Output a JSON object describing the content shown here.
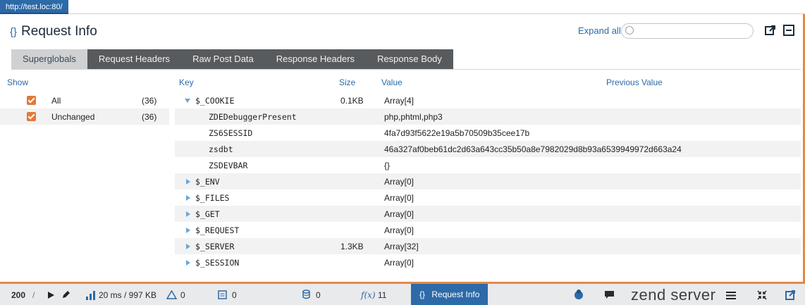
{
  "url_tab": "http://test.loc:80/",
  "header": {
    "brace": "{}",
    "title": "Request Info",
    "expand_all": "Expand all",
    "search_placeholder": "",
    "export_icon": "export-icon",
    "collapse_icon": "collapse-icon"
  },
  "tabs": [
    {
      "label": "Superglobals",
      "active": true
    },
    {
      "label": "Request Headers",
      "active": false
    },
    {
      "label": "Raw Post Data",
      "active": false
    },
    {
      "label": "Response Headers",
      "active": false
    },
    {
      "label": "Response Body",
      "active": false
    }
  ],
  "columns": {
    "show": "Show",
    "key": "Key",
    "size": "Size",
    "value": "Value",
    "previous_value": "Previous Value"
  },
  "show_filters": [
    {
      "label": "All",
      "count": "(36)",
      "checked": true
    },
    {
      "label": "Unchanged",
      "count": "(36)",
      "checked": true
    }
  ],
  "rows": [
    {
      "key": "$_COOKIE",
      "size": "0.1KB",
      "value": "Array[4]",
      "expandable": true,
      "expanded": true
    },
    {
      "key": "ZDEDebuggerPresent",
      "size": "",
      "value": "php,phtml,php3",
      "child": true
    },
    {
      "key": "ZS6SESSID",
      "size": "",
      "value": "4fa7d93f5622e19a5b70509b35cee17b",
      "child": true
    },
    {
      "key": "zsdbt",
      "size": "",
      "value": "46a327af0beb61dc2d63a643cc35b50a8e7982029d8b93a6539949972d663a24",
      "child": true
    },
    {
      "key": "ZSDEVBAR",
      "size": "",
      "value": "{}",
      "child": true
    },
    {
      "key": "$_ENV",
      "size": "",
      "value": "Array[0]",
      "expandable": true
    },
    {
      "key": "$_FILES",
      "size": "",
      "value": "Array[0]",
      "expandable": true
    },
    {
      "key": "$_GET",
      "size": "",
      "value": "Array[0]",
      "expandable": true
    },
    {
      "key": "$_REQUEST",
      "size": "",
      "value": "Array[0]",
      "expandable": true
    },
    {
      "key": "$_SERVER",
      "size": "1.3KB",
      "value": "Array[32]",
      "expandable": true
    },
    {
      "key": "$_SESSION",
      "size": "",
      "value": "Array[0]",
      "expandable": true
    }
  ],
  "toolbar": {
    "status_code": "200",
    "status_sep": "/",
    "timing": "20 ms / 997 KB",
    "warnings": "0",
    "logs": "0",
    "queries": "0",
    "functions_label": "f(x)",
    "functions": "11",
    "request_info": "Request Info",
    "request_info_brace": "{}",
    "brand": "zend server",
    "accent": "#e08a4a",
    "primary": "#2c6aa8"
  }
}
